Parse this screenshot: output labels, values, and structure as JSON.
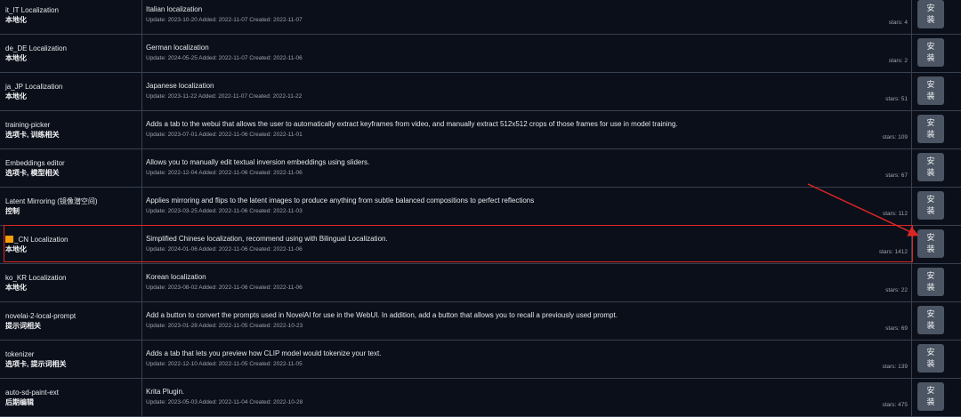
{
  "extensions": [
    {
      "name": "it_IT Localization",
      "tags": "本地化",
      "description": "Italian localization",
      "dates": "Update: 2023-10-20 Added: 2022-11-07 Created: 2022-11-07",
      "stars": "stars: 4",
      "button": [
        "安",
        "装"
      ]
    },
    {
      "name": "de_DE Localization",
      "tags": "本地化",
      "description": "German localization",
      "dates": "Update: 2024-05-25 Added: 2022-11-07 Created: 2022-11-06",
      "stars": "stars: 2",
      "button": [
        "安",
        "装"
      ]
    },
    {
      "name": "ja_JP Localization",
      "tags": "本地化",
      "description": "Japanese localization",
      "dates": "Update: 2023-11-22 Added: 2022-11-07 Created: 2022-11-22",
      "stars": "stars: 51",
      "button": [
        "安",
        "装"
      ]
    },
    {
      "name": "training-picker",
      "tags": "选项卡, 训练相关",
      "description": "Adds a tab to the webui that allows the user to automatically extract keyframes from video, and manually extract 512x512 crops of those frames for use in model training.",
      "dates": "Update: 2023-07-01 Added: 2022-11-06 Created: 2022-11-01",
      "stars": "stars: 109",
      "button": [
        "安",
        "装"
      ]
    },
    {
      "name": "Embeddings editor",
      "tags": "选项卡, 模型相关",
      "description": "Allows you to manually edit textual inversion embeddings using sliders.",
      "dates": "Update: 2022-12-04 Added: 2022-11-06 Created: 2022-11-06",
      "stars": "stars: 67",
      "button": [
        "安",
        "装"
      ]
    },
    {
      "name": "Latent Mirroring (镜像潜空间)",
      "tags": "控制",
      "description": "Applies mirroring and flips to the latent images to produce anything from subtle balanced compositions to perfect reflections",
      "dates": "Update: 2023-03-25 Added: 2022-11-06 Created: 2022-11-03",
      "stars": "stars: 112",
      "button": [
        "安",
        "装"
      ]
    },
    {
      "name": "_CN Localization",
      "tags": "本地化",
      "description": "Simplified Chinese localization, recommend using with Bilingual Localization.",
      "dates": "Update: 2024-01-06 Added: 2022-11-06 Created: 2022-11-06",
      "stars": "stars: 1412",
      "button": [
        "安",
        "装"
      ]
    },
    {
      "name": "ko_KR Localization",
      "tags": "本地化",
      "description": "Korean localization",
      "dates": "Update: 2023-08-02 Added: 2022-11-06 Created: 2022-11-06",
      "stars": "stars: 22",
      "button": [
        "安",
        "装"
      ]
    },
    {
      "name": "novelai-2-local-prompt",
      "tags": "提示词相关",
      "description": "Add a button to convert the prompts used in NovelAI for use in the WebUI. In addition, add a button that allows you to recall a previously used prompt.",
      "dates": "Update: 2023-01-28 Added: 2022-11-05 Created: 2022-10-23",
      "stars": "stars: 69",
      "button": [
        "安",
        "装"
      ]
    },
    {
      "name": "tokenizer",
      "tags": "选项卡, 提示词相关",
      "description": "Adds a tab that lets you preview how CLIP model would tokenize your text.",
      "dates": "Update: 2022-12-10 Added: 2022-11-05 Created: 2022-11-05",
      "stars": "stars: 139",
      "button": [
        "安",
        "装"
      ]
    },
    {
      "name": "auto-sd-paint-ext",
      "tags": "后期编辑",
      "description": "Krita Plugin.",
      "dates": "Update: 2023-05-03 Added: 2022-11-04 Created: 2022-10-28",
      "stars": "stars: 475",
      "button": [
        "安",
        "装"
      ]
    }
  ],
  "colors": {
    "highlight": "#dc2626",
    "button_bg": "#4b5563",
    "background": "#0b0f19"
  }
}
